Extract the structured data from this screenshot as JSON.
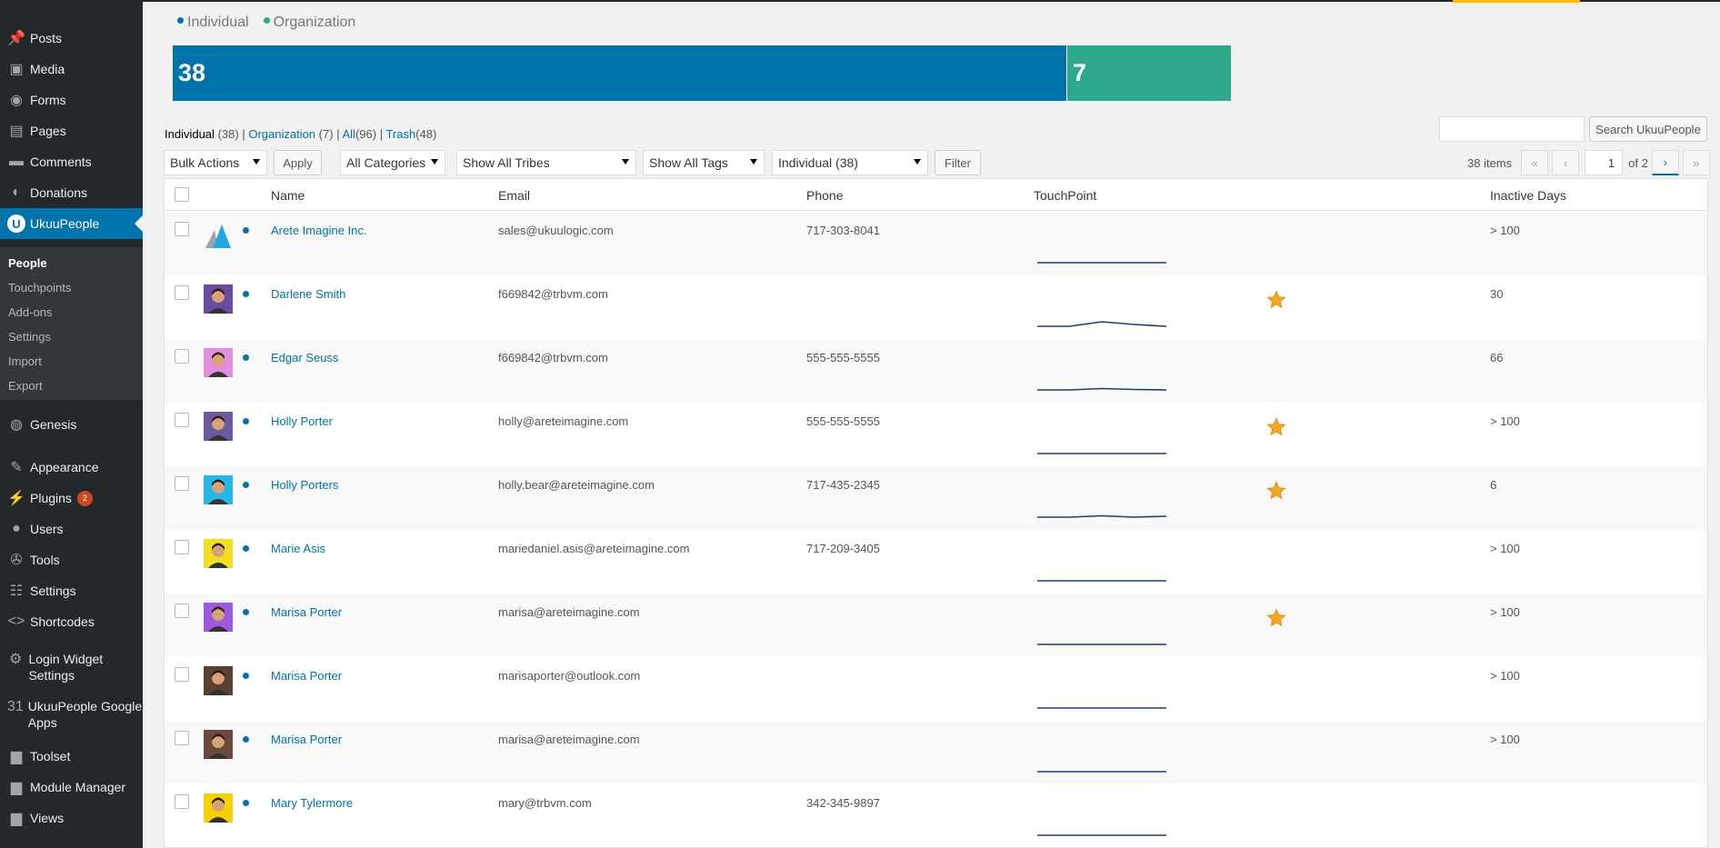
{
  "sidebar": {
    "items": [
      {
        "label": "Posts",
        "icon": "pushpin-icon",
        "glyph": "📌"
      },
      {
        "label": "Media",
        "icon": "media-icon",
        "glyph": "▣"
      },
      {
        "label": "Forms",
        "icon": "forms-icon",
        "glyph": "◉"
      },
      {
        "label": "Pages",
        "icon": "pages-icon",
        "glyph": "▤"
      },
      {
        "label": "Comments",
        "icon": "comment-icon",
        "glyph": "▬"
      },
      {
        "label": "Donations",
        "icon": "donations-icon",
        "glyph": "◐"
      },
      {
        "label": "UkuuPeople",
        "icon": "ukuupeople-logo-icon",
        "glyph": "U",
        "active": true
      },
      {
        "label": "Genesis",
        "icon": "genesis-icon",
        "glyph": "◍"
      },
      {
        "label": "Appearance",
        "icon": "paintbrush-icon",
        "glyph": "✎"
      },
      {
        "label": "Plugins",
        "icon": "plug-icon",
        "glyph": "⚡",
        "badge": "2"
      },
      {
        "label": "Users",
        "icon": "user-icon",
        "glyph": "●"
      },
      {
        "label": "Tools",
        "icon": "wrench-icon",
        "glyph": "✇"
      },
      {
        "label": "Settings",
        "icon": "sliders-icon",
        "glyph": "☷"
      },
      {
        "label": "Shortcodes",
        "icon": "code-icon",
        "glyph": "<>"
      },
      {
        "label": "Login Widget Settings",
        "icon": "gear-icon",
        "glyph": "⚙"
      },
      {
        "label": "UkuuPeople Google Apps",
        "icon": "calendar-icon",
        "glyph": "31"
      },
      {
        "label": "Toolset",
        "icon": "toolset-icon",
        "glyph": "▆"
      },
      {
        "label": "Module Manager",
        "icon": "module-icon",
        "glyph": "▆"
      },
      {
        "label": "Views",
        "icon": "views-icon",
        "glyph": "▆"
      }
    ],
    "submenu": [
      "People",
      "Touchpoints",
      "Add-ons",
      "Settings",
      "Import",
      "Export"
    ]
  },
  "summary": {
    "legend": [
      {
        "label": "Individual",
        "color": "#0073aa"
      },
      {
        "label": "Organization",
        "color": "#2ea88a"
      }
    ],
    "bars": [
      {
        "label": "38",
        "value": 38,
        "color": "#0073aa"
      },
      {
        "label": "7",
        "value": 7,
        "color": "#2ea88a"
      }
    ]
  },
  "views": {
    "individual": "Individual",
    "individual_count": "(38)",
    "organization": "Organization",
    "organization_count": "(7)",
    "all": "All",
    "all_count": "(96)",
    "trash": "Trash",
    "trash_count": "(48)",
    "sep": "|"
  },
  "search": {
    "button": "Search UkuuPeople",
    "value": ""
  },
  "filters": {
    "bulk_actions": "Bulk Actions",
    "apply": "Apply",
    "categories": "All Categories",
    "tribes": "Show All Tribes",
    "tags": "Show All Tags",
    "type": "Individual (38)",
    "filter": "Filter"
  },
  "pagination": {
    "items": "38 items",
    "first": "«",
    "prev": "‹",
    "current": "1",
    "of": "of 2",
    "next": "›",
    "last": "»"
  },
  "table": {
    "headers": {
      "name": "Name",
      "email": "Email",
      "phone": "Phone",
      "touchpoint": "TouchPoint",
      "inactive": "Inactive Days"
    },
    "rows": [
      {
        "name": "Arete Imagine Inc.",
        "email": "sales@ukuulogic.com",
        "phone": "717-303-8041",
        "inactive": "> 100",
        "favorite": false,
        "avatar": "org",
        "spark": [
          0,
          0,
          0,
          0,
          0
        ]
      },
      {
        "name": "Darlene Smith",
        "email": "f669842@trbvm.com",
        "phone": "",
        "inactive": "30",
        "favorite": true,
        "avatar": "p1",
        "spark": [
          0,
          0,
          1,
          0.4,
          0
        ]
      },
      {
        "name": "Edgar Seuss",
        "email": "f669842@trbvm.com",
        "phone": "555-555-5555",
        "inactive": "66",
        "favorite": false,
        "avatar": "p2",
        "spark": [
          0,
          0,
          0.3,
          0.1,
          0
        ]
      },
      {
        "name": "Holly Porter",
        "email": "holly@areteimagine.com",
        "phone": "555-555-5555",
        "inactive": "> 100",
        "favorite": true,
        "avatar": "p3",
        "spark": [
          0,
          0,
          0,
          0,
          0
        ]
      },
      {
        "name": "Holly Porters",
        "email": "holly.bear@areteimagine.com",
        "phone": "717-435-2345",
        "inactive": "6",
        "favorite": true,
        "avatar": "p4",
        "spark": [
          0,
          0,
          0.3,
          0,
          0.2
        ]
      },
      {
        "name": "Marie Asis",
        "email": "mariedaniel.asis@areteimagine.com",
        "phone": "717-209-3405",
        "inactive": "> 100",
        "favorite": false,
        "avatar": "p5",
        "spark": [
          0,
          0,
          0,
          0,
          0
        ]
      },
      {
        "name": "Marisa Porter",
        "email": "marisa@areteimagine.com",
        "phone": "",
        "inactive": "> 100",
        "favorite": true,
        "avatar": "p6",
        "spark": [
          0,
          0,
          0,
          0,
          0
        ]
      },
      {
        "name": "Marisa Porter",
        "email": "marisaporter@outlook.com",
        "phone": "",
        "inactive": "> 100",
        "favorite": false,
        "avatar": "p7",
        "spark": [
          0,
          0,
          0,
          0,
          0
        ]
      },
      {
        "name": "Marisa Porter",
        "email": "marisa@areteimagine.com",
        "phone": "",
        "inactive": "> 100",
        "favorite": false,
        "avatar": "p8",
        "spark": [
          0,
          0,
          0,
          0,
          0
        ]
      },
      {
        "name": "Mary Tylermore",
        "email": "mary@trbvm.com",
        "phone": "342-345-9897",
        "inactive": "",
        "favorite": false,
        "avatar": "p9",
        "spark": [
          0,
          0,
          0,
          0,
          0
        ]
      }
    ]
  },
  "colors": {
    "accent": "#0073aa",
    "org": "#2ea88a",
    "star": "#f5a623",
    "spark": "#1f3b73"
  }
}
